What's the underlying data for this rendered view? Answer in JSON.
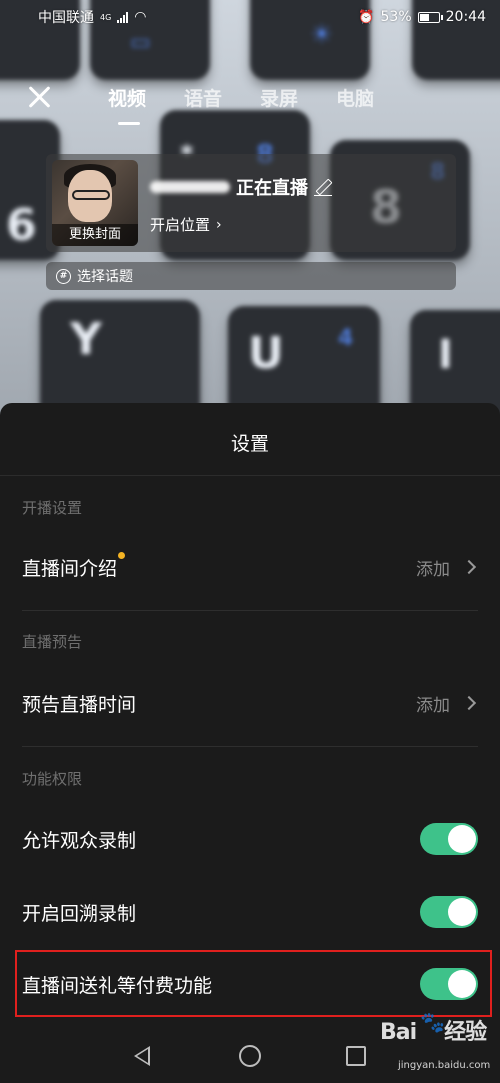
{
  "status_bar": {
    "carrier": "中国联通",
    "network": "4G",
    "battery_pct": "53%",
    "battery_level": 0.53,
    "time": "20:44"
  },
  "top_nav": {
    "tabs": [
      {
        "label": "视频",
        "active": true
      },
      {
        "label": "语音",
        "active": false
      },
      {
        "label": "录屏",
        "active": false
      },
      {
        "label": "电脑",
        "active": false
      }
    ]
  },
  "info_card": {
    "cover_label": "更换封面",
    "title_suffix": "正在直播",
    "location_label": "开启位置",
    "topic_label": "选择话题"
  },
  "sheet": {
    "title": "设置",
    "sections": [
      {
        "label": "开播设置",
        "rows": [
          {
            "label": "直播间介绍",
            "value": "添加",
            "has_dot": true
          }
        ]
      },
      {
        "label": "直播预告",
        "rows": [
          {
            "label": "预告直播时间",
            "value": "添加",
            "has_dot": false
          }
        ]
      },
      {
        "label": "功能权限",
        "rows": [
          {
            "label": "允许观众录制",
            "toggle": true
          },
          {
            "label": "开启回溯录制",
            "toggle": true
          },
          {
            "label": "直播间送礼等付费功能",
            "toggle": true
          }
        ]
      }
    ]
  },
  "watermark": {
    "brand": "Bai",
    "brand_tail": "经验",
    "site": "jingyan.baidu.com"
  },
  "colors": {
    "toggle_on": "#3ec28a",
    "highlight": "#e0201e",
    "dot": "#f4b323",
    "sheet_bg": "#1b1b1b"
  }
}
